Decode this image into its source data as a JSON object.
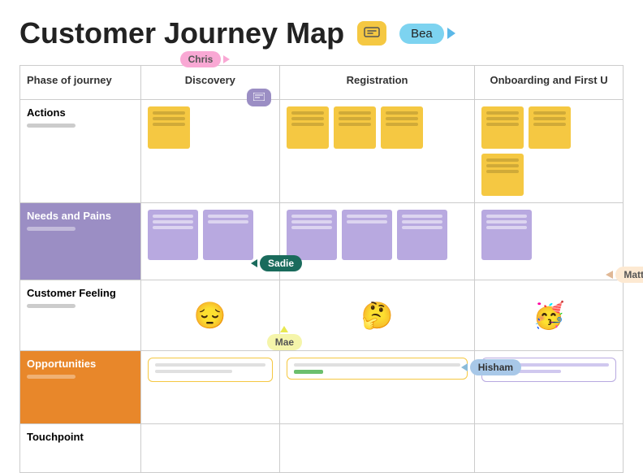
{
  "header": {
    "title": "Customer Journey Map",
    "chat_icon": "💬",
    "bea_label": "Bea"
  },
  "columns": [
    {
      "key": "phase",
      "label": "Phase of journey"
    },
    {
      "key": "discovery",
      "label": "Discovery"
    },
    {
      "key": "registration",
      "label": "Registration"
    },
    {
      "key": "onboarding",
      "label": "Onboarding and First U"
    }
  ],
  "rows": [
    {
      "key": "actions",
      "label": "Actions",
      "type": "actions"
    },
    {
      "key": "needs",
      "label": "Needs and Pains",
      "type": "needs"
    },
    {
      "key": "feeling",
      "label": "Customer Feeling",
      "type": "feeling"
    },
    {
      "key": "opportunities",
      "label": "Opportunities",
      "type": "opportunities"
    },
    {
      "key": "touchpoint",
      "label": "Touchpoint",
      "type": "touchpoint"
    }
  ],
  "cursors": {
    "chris": "Chris",
    "bea": "Bea",
    "sadie": "Sadie",
    "matt": "Matt",
    "mae": "Mae",
    "hisham": "Hisham"
  },
  "emojis": {
    "feeling_discovery": "😔",
    "feeling_registration": "🤔",
    "feeling_onboarding": "🥳"
  }
}
